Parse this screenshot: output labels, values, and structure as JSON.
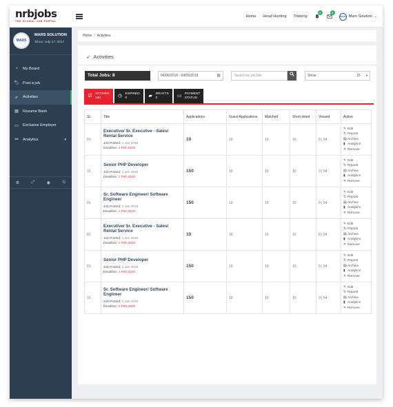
{
  "brand": {
    "name": "nrbjobs",
    "tagline": "THE GLOBAL JOB PORTAL"
  },
  "topnav": {
    "links": [
      "Home",
      "Head Hunting",
      "Training"
    ],
    "bell_count": "4",
    "mail_count": "8",
    "user": "Mars Solution",
    "avatar_text": "MARS"
  },
  "sidebar": {
    "profile": {
      "name": "MARS SOLUTION",
      "since": "Since: July 17, 2017",
      "avatar_text": "MARS"
    },
    "items": [
      {
        "label": "My Board",
        "icon": "dashboard-icon"
      },
      {
        "label": "Post a job",
        "icon": "tag-icon"
      },
      {
        "label": "Activities",
        "icon": "rocket-icon",
        "active": true
      },
      {
        "label": "Resume Bank",
        "icon": "document-icon"
      },
      {
        "label": "Exclusive Employer",
        "icon": "note-icon"
      },
      {
        "label": "Analytics",
        "icon": "sitemap-icon"
      }
    ]
  },
  "breadcrumb": [
    "Home",
    "Activities"
  ],
  "page": {
    "title": "Activities",
    "total_jobs": "Total Jobs: 8",
    "date_range": "04/05/2018 - 04/05/2018",
    "search_placeholder": "Search by job title",
    "show_label": "Show",
    "show_value": "15"
  },
  "tabs": [
    {
      "label": "ACTIVES",
      "count": "100",
      "active": true
    },
    {
      "label": "EXPIRED",
      "count": "0"
    },
    {
      "label": "DRAFTS",
      "count": "0"
    },
    {
      "label": "PAYMENT",
      "count": "STATUS"
    }
  ],
  "table": {
    "headers": [
      "SL",
      "Title",
      "Applications",
      "Guest Applications",
      "Matched",
      "Short-listed",
      "Viewed",
      "Action"
    ],
    "meta_labels": {
      "posted": "Job Posted:",
      "deadline": "Deadline:"
    },
    "actions": [
      "Edit",
      "Repost",
      "Archive",
      "Analytics",
      "Remove"
    ],
    "rows": [
      {
        "sl": "01",
        "title": "Executive/ Sr. Executive - Sales/ Rental Service",
        "posted": "1 Jan 2018",
        "deadline": "1 Feb 2018",
        "applications": "10",
        "guest": "10",
        "matched": "10",
        "shortlisted": "10",
        "viewed": "0 | 54"
      },
      {
        "sl": "01",
        "title": "Senior PHP Developer",
        "posted": "1 Jan 2018",
        "deadline": "1 Feb 2018",
        "applications": "150",
        "guest": "10",
        "matched": "10",
        "shortlisted": "10",
        "viewed": "0 | 54"
      },
      {
        "sl": "01",
        "title": "Sr. Software Engineer/ Software Engineer",
        "posted": "1 Jan 2018",
        "deadline": "1 Feb 2018",
        "applications": "150",
        "guest": "10",
        "matched": "10",
        "shortlisted": "10",
        "viewed": "0 | 54"
      },
      {
        "sl": "01",
        "title": "Executive/ Sr. Executive - Sales/ Rental Service",
        "posted": "1 Jan 2018",
        "deadline": "1 Feb 2018",
        "applications": "10",
        "guest": "10",
        "matched": "10",
        "shortlisted": "10",
        "viewed": "0 | 54"
      },
      {
        "sl": "01",
        "title": "Senior PHP Developer",
        "posted": "1 Jan 2018",
        "deadline": "1 Feb 2018",
        "applications": "150",
        "guest": "10",
        "matched": "10",
        "shortlisted": "10",
        "viewed": "0 | 54"
      },
      {
        "sl": "01",
        "title": "Sr. Software Engineer/ Software Engineer",
        "posted": "1 Jan 2018",
        "deadline": "1 Feb 2018",
        "applications": "150",
        "guest": "10",
        "matched": "10",
        "shortlisted": "10",
        "viewed": "0 | 54"
      }
    ]
  },
  "colors": {
    "sidebar": "#2c3e50",
    "accent_red": "#e8232f",
    "badge_green": "#2bb673",
    "title_blue": "#34495e"
  }
}
